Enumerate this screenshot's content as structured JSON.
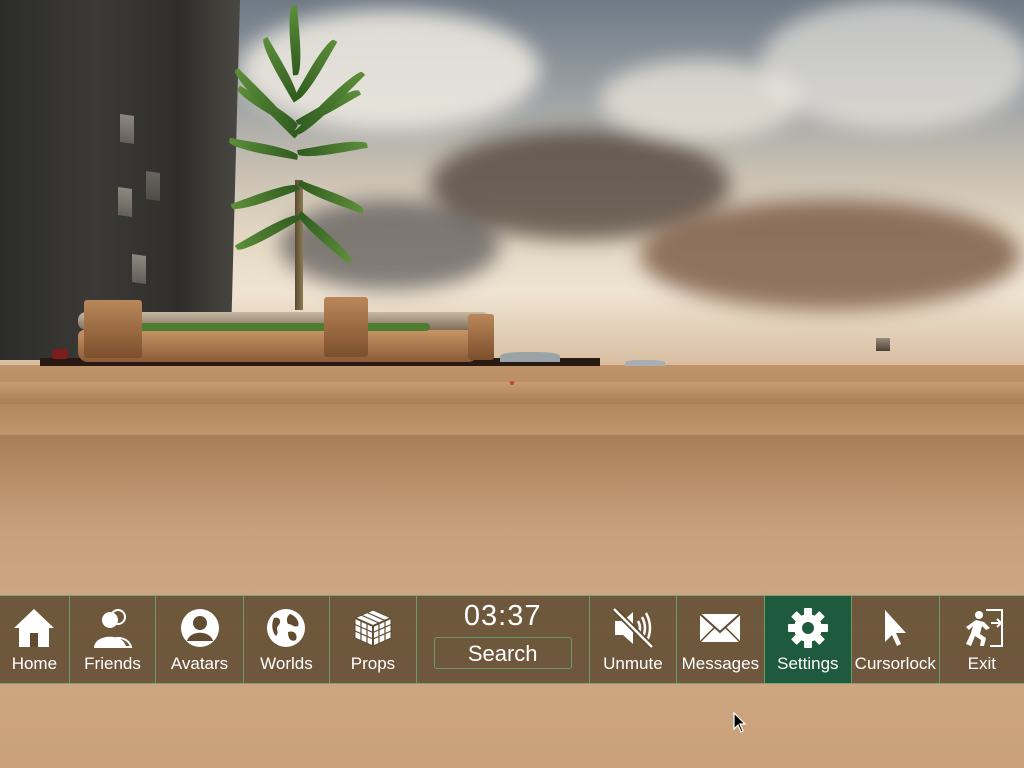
{
  "hud": {
    "clock": "03:37",
    "search_label": "Search",
    "menu": [
      {
        "label": "Home",
        "icon": "home-icon",
        "active": false
      },
      {
        "label": "Friends",
        "icon": "friends-icon",
        "active": false
      },
      {
        "label": "Avatars",
        "icon": "avatar-icon",
        "active": false
      },
      {
        "label": "Worlds",
        "icon": "globe-icon",
        "active": false
      },
      {
        "label": "Props",
        "icon": "cube-icon",
        "active": false
      },
      {
        "label": "Unmute",
        "icon": "muted-speaker-icon",
        "active": false
      },
      {
        "label": "Messages",
        "icon": "envelope-icon",
        "active": false
      },
      {
        "label": "Settings",
        "icon": "gear-icon",
        "active": true
      },
      {
        "label": "Cursorlock",
        "icon": "cursor-arrow-icon",
        "active": false
      },
      {
        "label": "Exit",
        "icon": "exit-door-icon",
        "active": false
      }
    ]
  },
  "colors": {
    "bar_background": "#614c32",
    "bar_border": "#7fa07a",
    "active_button": "#1f5a3f",
    "text": "#ffffff"
  }
}
